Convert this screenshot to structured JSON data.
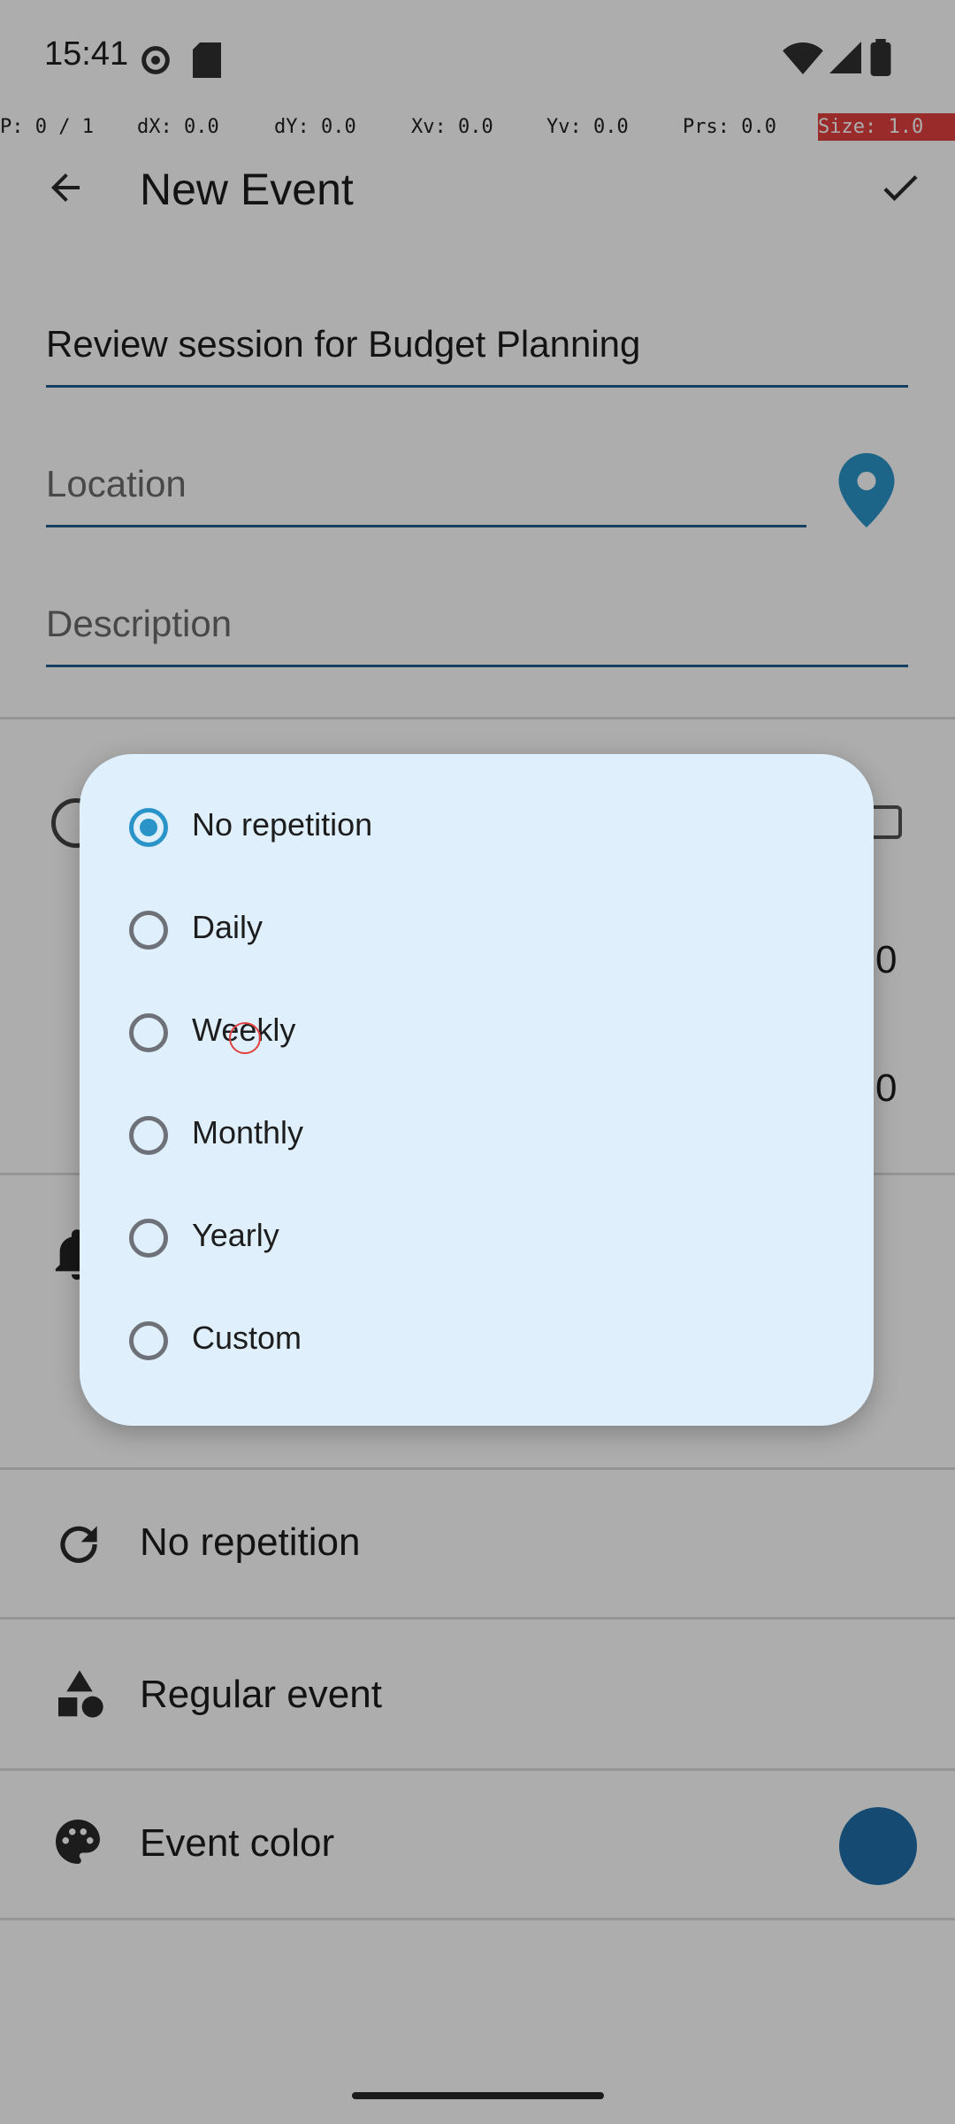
{
  "status_bar": {
    "time": "15:41"
  },
  "pointer_bar": [
    "P: 0 / 1",
    "dX: 0.0",
    "dY: 0.0",
    "Xv: 0.0",
    "Yv: 0.0",
    "Prs: 0.0",
    "Size: 1.0"
  ],
  "app_bar": {
    "title": "New Event"
  },
  "form": {
    "title_value": "Review session for Budget Planning",
    "location_placeholder": "Location",
    "description_placeholder": "Description",
    "time_fragment_1": "0",
    "time_fragment_2": "0"
  },
  "rows": {
    "repetition": "No repetition",
    "event_type": "Regular event",
    "event_color": "Event color"
  },
  "colors": {
    "accent": "#2a94c9",
    "event_color": "#1f6fa8"
  },
  "dialog": {
    "options": [
      {
        "label": "No repetition",
        "selected": true
      },
      {
        "label": "Daily",
        "selected": false
      },
      {
        "label": "Weekly",
        "selected": false
      },
      {
        "label": "Monthly",
        "selected": false
      },
      {
        "label": "Yearly",
        "selected": false
      },
      {
        "label": "Custom",
        "selected": false
      }
    ]
  }
}
